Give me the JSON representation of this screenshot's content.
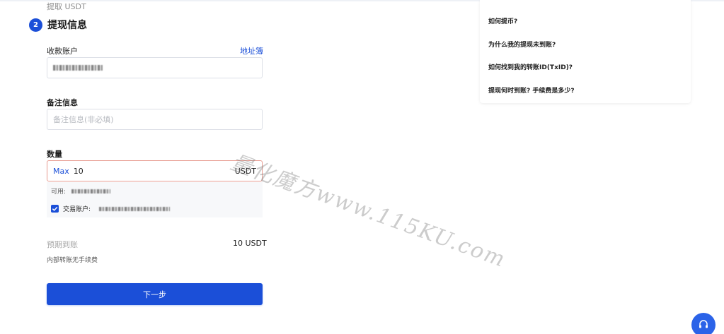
{
  "breadcrumb": "提取 USDT",
  "step": {
    "number": "2",
    "title": "提现信息"
  },
  "account": {
    "label": "收款账户",
    "address_book_link": "地址簿"
  },
  "remark": {
    "label": "备注信息",
    "placeholder": "备注信息(非必填)"
  },
  "amount": {
    "label": "数量",
    "max_label": "Max",
    "value": "10",
    "unit": "USDT"
  },
  "available": {
    "label": "可用:"
  },
  "trading_account": {
    "label": "交易账户:",
    "checked": true
  },
  "expected": {
    "label": "预期到账",
    "value": "10 USDT",
    "fee_note": "内部转账无手续费"
  },
  "next_button": "下一步",
  "faq": [
    "如何提币?",
    "为什么我的提现未到账?",
    "如何找到我的转账ID(TxID)?",
    "提现何时到账? 手续费是多少?"
  ],
  "watermark": "量化魔方www.115KU.com",
  "colors": {
    "accent": "#1b4fd8",
    "error_border": "#e79a8f"
  },
  "icons": {
    "support": "headset-icon",
    "check": "check-icon"
  }
}
